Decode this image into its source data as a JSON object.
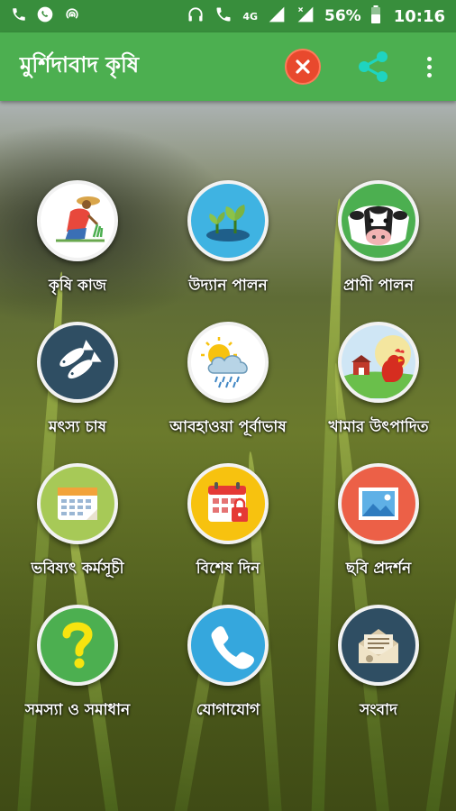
{
  "status_bar": {
    "battery": "56%",
    "network": "4G",
    "time": "10:16",
    "left_icons": [
      "phone-icon",
      "whatsapp-icon",
      "hotspot-icon"
    ],
    "right_icons": [
      "headphones-icon",
      "volte-call-icon",
      "signal-icon",
      "signal-x-icon",
      "battery-icon"
    ]
  },
  "app_bar": {
    "title": "মুর্শিদাবাদ কৃষি",
    "actions": [
      "close-icon",
      "share-icon",
      "more-vert-icon"
    ],
    "close_color": "#e8492d",
    "share_color": "#1fd4c0"
  },
  "colors": {
    "status_bar": "#388e3c",
    "app_bar": "#4caf50"
  },
  "tiles": [
    {
      "label": "কৃষি কাজ",
      "icon": "farmer-icon",
      "bg": "#ffffff"
    },
    {
      "label": "উদ্যান পালন",
      "icon": "seedling-icon",
      "bg": "#3fb3e2"
    },
    {
      "label": "প্রাণী পালন",
      "icon": "cow-icon",
      "bg": "#4caf50"
    },
    {
      "label": "মৎস্য চাষ",
      "icon": "fish-icon",
      "bg": "#2f4e63"
    },
    {
      "label": "আবহাওয়া পূর্বাভাষ",
      "icon": "weather-icon",
      "bg": "#ffffff"
    },
    {
      "label": "খামার উৎপাদিত",
      "icon": "rooster-farm-icon",
      "bg": "#cfe6f5"
    },
    {
      "label": "ভবিষ্যৎ কর্মসূচী",
      "icon": "calendar-icon",
      "bg": "#a7c957"
    },
    {
      "label": "বিশেষ দিন",
      "icon": "calendar-lock-icon",
      "bg": "#f7c20f"
    },
    {
      "label": "ছবি প্রদর্শন",
      "icon": "picture-icon",
      "bg": "#ec6047"
    },
    {
      "label": "সমস্যা ও সমাধান",
      "icon": "question-icon",
      "bg": "#4caf50"
    },
    {
      "label": "যোগাযোগ",
      "icon": "phone-icon",
      "bg": "#35a7dd"
    },
    {
      "label": "সংবাদ",
      "icon": "news-envelope-icon",
      "bg": "#2f4e63"
    }
  ]
}
